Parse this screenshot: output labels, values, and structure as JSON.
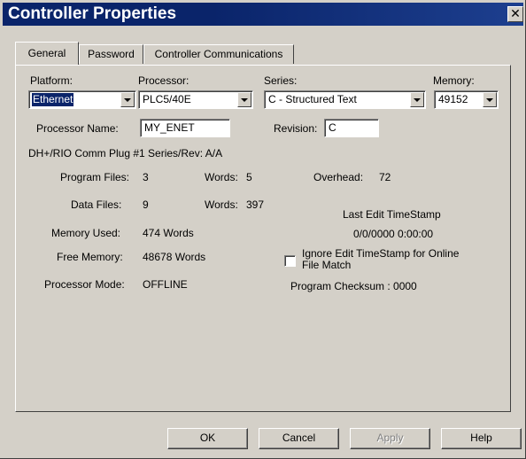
{
  "window": {
    "title": "Controller Properties",
    "close_glyph": "✕"
  },
  "tabs": [
    {
      "label": "General"
    },
    {
      "label": "Password"
    },
    {
      "label": "Controller Communications"
    }
  ],
  "platform": {
    "label": "Platform:",
    "value": "Ethernet"
  },
  "processor": {
    "label": "Processor:",
    "value": "PLC5/40E"
  },
  "series": {
    "label": "Series:",
    "value": "C - Structured Text"
  },
  "memory": {
    "label": "Memory:",
    "value": "49152"
  },
  "processor_name": {
    "label": "Processor Name:",
    "value": "MY_ENET"
  },
  "revision": {
    "label": "Revision:",
    "value": "C"
  },
  "comm_plug": "DH+/RIO Comm Plug #1 Series/Rev:  A/A",
  "stats": {
    "program_files_label": "Program Files:",
    "program_files": "3",
    "program_words_label": "Words:",
    "program_words": "5",
    "overhead_label": "Overhead:",
    "overhead": "72",
    "data_files_label": "Data Files:",
    "data_files": "9",
    "data_words_label": "Words:",
    "data_words": "397",
    "memory_used_label": "Memory Used:",
    "memory_used": "474 Words",
    "free_memory_label": "Free Memory:",
    "free_memory": "48678 Words",
    "processor_mode_label": "Processor Mode:",
    "processor_mode": "OFFLINE"
  },
  "timestamp": {
    "label": "Last Edit TimeStamp",
    "value": "0/0/0000  0:00:00",
    "ignore_label_line1": "Ignore Edit TimeStamp for Online",
    "ignore_label_line2": "File Match",
    "ignore_checked": false
  },
  "checksum": "Program Checksum :  0000",
  "buttons": {
    "ok": "OK",
    "cancel": "Cancel",
    "apply": "Apply",
    "help": "Help"
  }
}
